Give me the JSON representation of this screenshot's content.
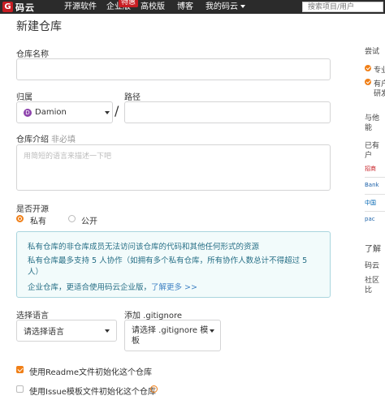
{
  "topbar": {
    "logo_mark": "G",
    "logo_text": "码云",
    "nav": [
      "开源软件",
      "企业版",
      "高校版",
      "博客",
      "我的码云"
    ],
    "badge": "特惠",
    "search_placeholder": "搜索项目/用户"
  },
  "page": {
    "title": "新建仓库"
  },
  "form": {
    "repo_name_label": "仓库名称",
    "owner_label": "归属",
    "owner_value": "Damion",
    "owner_avatar": "D",
    "path_label": "路径",
    "path_sep": "/",
    "desc_label": "仓库介绍",
    "desc_sub": "非必填",
    "desc_placeholder": "用简短的语言来描述一下吧",
    "visibility_label": "是否开源",
    "private_label": "私有",
    "public_label": "公开",
    "info_line1": "私有仓库的非仓库成员无法访问该仓库的代码和其他任何形式的资源",
    "info_line2": "私有仓库最多支持 5 人协作（如拥有多个私有仓库，所有协作人数总计不得超过 5",
    "info_line3": "人）",
    "info_line4": "企业仓库，更适合使用码云企业版，",
    "info_link": "了解更多 >>",
    "language_label": "选择语言",
    "language_value": "请选择语言",
    "gitignore_label": "添加 .gitignore",
    "gitignore_value_1": "请选择 .gitignore 模",
    "gitignore_value_2": "板",
    "readme_label": "使用Readme文件初始化这个仓库",
    "issue_label": "使用Issue模板文件初始化这个仓库"
  },
  "sidebar": {
    "line1": "尝试",
    "item1": "专业",
    "item2": "有户",
    "item2b": "研发",
    "line2": "与他",
    "line2b": "能",
    "line3": "已有",
    "line3b": "户",
    "logo1": "招商",
    "logo2": "Bank",
    "logo3": "中国",
    "logo4": "pac",
    "more_label": "了解",
    "more1": "码云",
    "more2": "社区",
    "more2b": "比"
  }
}
